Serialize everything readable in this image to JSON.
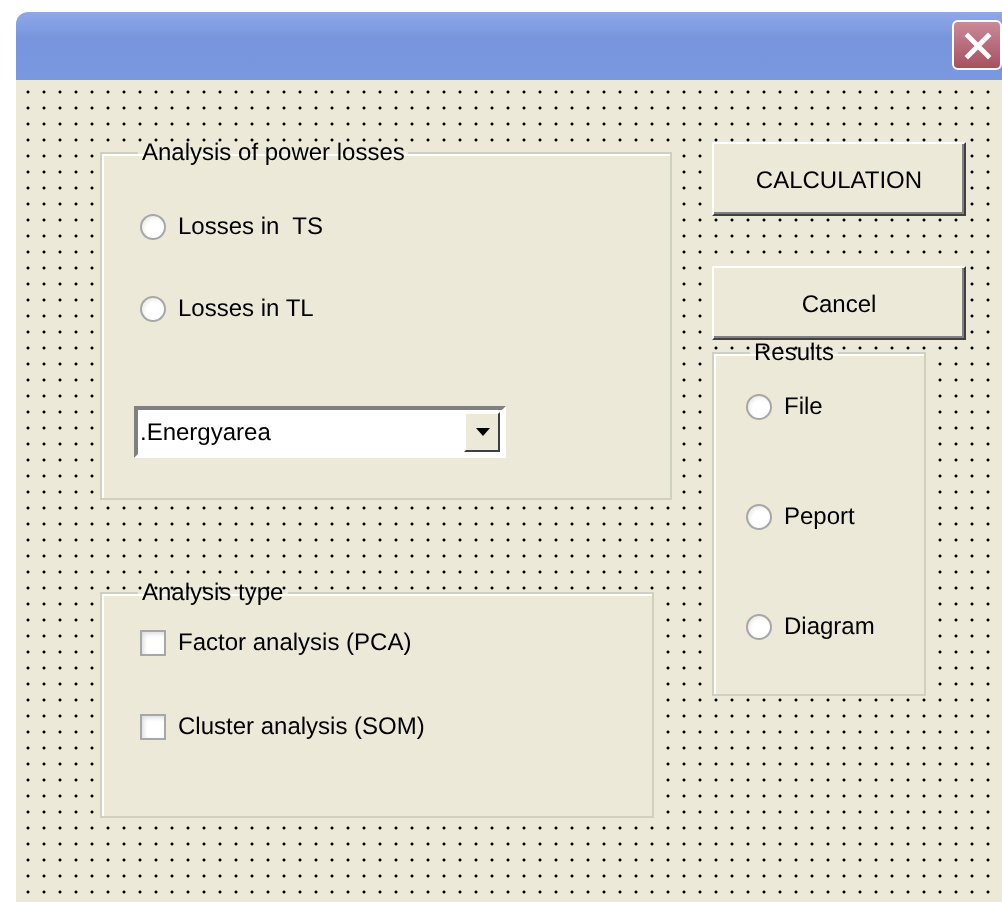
{
  "power_losses": {
    "title": "Analysis of power losses",
    "options": [
      {
        "label": "Losses in  TS",
        "selected": false
      },
      {
        "label": "Losses in TL",
        "selected": false
      }
    ],
    "dropdown": {
      "value": ".Energyarea"
    }
  },
  "analysis_type": {
    "title": "Analysis type",
    "options": [
      {
        "label": "Factor analysis (PCA)",
        "checked": false
      },
      {
        "label": "Cluster analysis (SOM)",
        "checked": false
      }
    ]
  },
  "buttons": [
    "CALCULATION",
    "Cancel"
  ],
  "results": {
    "title": "Results",
    "options": [
      {
        "label": "File",
        "selected": false
      },
      {
        "label": "Peport",
        "selected": false
      },
      {
        "label": "Diagram",
        "selected": false
      }
    ]
  }
}
